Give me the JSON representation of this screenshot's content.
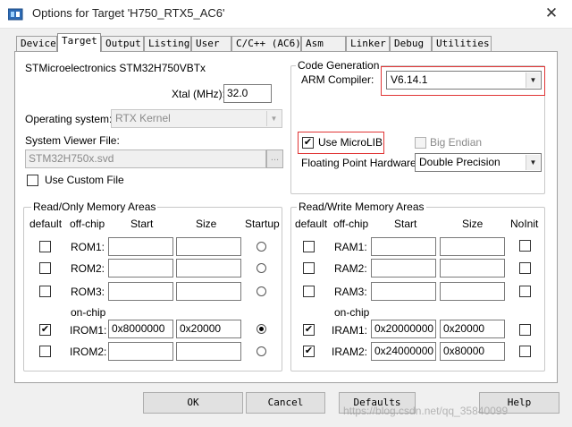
{
  "window": {
    "title": "Options for Target 'H750_RTX5_AC6'",
    "close_glyph": "✕",
    "icon": "keil-app-icon"
  },
  "tabs": [
    {
      "label": "Device",
      "active": false
    },
    {
      "label": "Target",
      "active": true
    },
    {
      "label": "Output",
      "active": false
    },
    {
      "label": "Listing",
      "active": false
    },
    {
      "label": "User",
      "active": false
    },
    {
      "label": "C/C++ (AC6)",
      "active": false
    },
    {
      "label": "Asm",
      "active": false
    },
    {
      "label": "Linker",
      "active": false
    },
    {
      "label": "Debug",
      "active": false
    },
    {
      "label": "Utilities",
      "active": false
    }
  ],
  "target": {
    "device_name": "STMicroelectronics STM32H750VBTx",
    "xtal_label": "Xtal (MHz):",
    "xtal_value": "32.0",
    "os_label": "Operating system:",
    "os_value": "RTX Kernel",
    "svf_label": "System Viewer File:",
    "svf_value": "STM32H750x.svd",
    "browse_label": "...",
    "custom_file_label": "Use Custom File",
    "custom_file_checked": false
  },
  "code_generation": {
    "legend": "Code Generation",
    "compiler_label": "ARM Compiler:",
    "compiler_value": "V6.14.1",
    "microlib_label": "Use MicroLIB",
    "microlib_checked": true,
    "big_endian_label": "Big Endian",
    "big_endian_checked": false,
    "fp_label": "Floating Point Hardware:",
    "fp_value": "Double Precision"
  },
  "ro_memory": {
    "legend": "Read/Only Memory Areas",
    "headers": {
      "default": "default",
      "offchip": "off-chip",
      "start": "Start",
      "size": "Size",
      "startup": "Startup"
    },
    "onchip_label": "on-chip",
    "rows": [
      {
        "name": "ROM1:",
        "default": false,
        "start": "",
        "size": "",
        "startup": false
      },
      {
        "name": "ROM2:",
        "default": false,
        "start": "",
        "size": "",
        "startup": false
      },
      {
        "name": "ROM3:",
        "default": false,
        "start": "",
        "size": "",
        "startup": false
      },
      {
        "name": "IROM1:",
        "default": true,
        "start": "0x8000000",
        "size": "0x20000",
        "startup": true
      },
      {
        "name": "IROM2:",
        "default": false,
        "start": "",
        "size": "",
        "startup": false
      }
    ]
  },
  "rw_memory": {
    "legend": "Read/Write Memory Areas",
    "headers": {
      "default": "default",
      "offchip": "off-chip",
      "start": "Start",
      "size": "Size",
      "noinit": "NoInit"
    },
    "onchip_label": "on-chip",
    "rows": [
      {
        "name": "RAM1:",
        "default": false,
        "start": "",
        "size": "",
        "noinit": false
      },
      {
        "name": "RAM2:",
        "default": false,
        "start": "",
        "size": "",
        "noinit": false
      },
      {
        "name": "RAM3:",
        "default": false,
        "start": "",
        "size": "",
        "noinit": false
      },
      {
        "name": "IRAM1:",
        "default": true,
        "start": "0x20000000",
        "size": "0x20000",
        "noinit": false
      },
      {
        "name": "IRAM2:",
        "default": true,
        "start": "0x24000000",
        "size": "0x80000",
        "noinit": false
      }
    ]
  },
  "buttons": {
    "ok": "OK",
    "cancel": "Cancel",
    "defaults": "Defaults",
    "help": "Help"
  },
  "watermark": "https://blog.csdn.net/qq_35840099",
  "colors": {
    "highlight": "#e03535"
  }
}
